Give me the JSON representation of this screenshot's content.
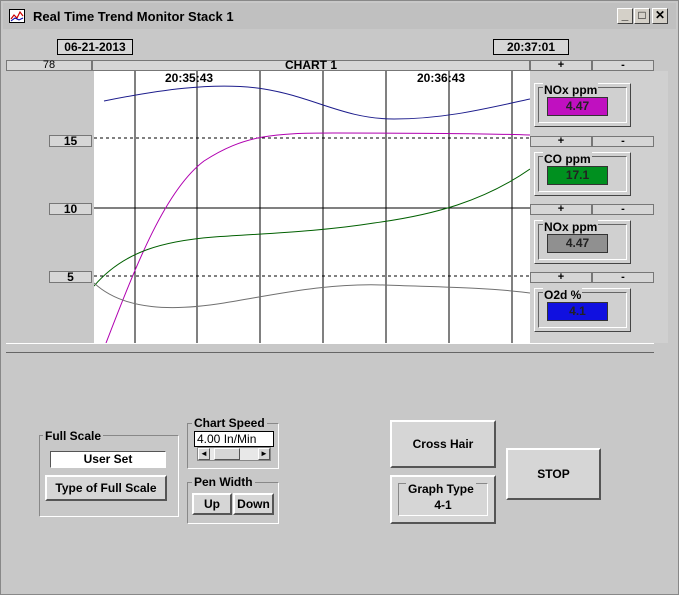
{
  "window": {
    "title": "Real Time Trend Monitor  Stack 1",
    "minimize": "_",
    "maximize": "□",
    "close": "✕"
  },
  "header": {
    "date": "06-21-2013",
    "time": "20:37:01",
    "chart_title": "CHART 1",
    "scroll_label": "78"
  },
  "chart": {
    "timestamps": [
      "20:35:43",
      "20:36:43"
    ],
    "y_labels": [
      "15",
      "10",
      "5"
    ],
    "series_colors": {
      "nox_top": "#1c1c8c",
      "co": "#b000b0",
      "nox": "#006000",
      "o2d": "#707070"
    }
  },
  "channels": [
    {
      "label": "NOx ppm",
      "value": "4.47",
      "color": "#c010c0",
      "plus": "+",
      "minus": "-"
    },
    {
      "label": "CO ppm",
      "value": "17.1",
      "color": "#00901f",
      "plus": "+",
      "minus": "-"
    },
    {
      "label": "NOx ppm",
      "value": "4.47",
      "color": "#909090",
      "plus": "+",
      "minus": "-"
    },
    {
      "label": "O2d %",
      "value": "4.1",
      "color": "#1010e0",
      "plus": "+",
      "minus": "-"
    }
  ],
  "full_scale": {
    "group_label": "Full Scale",
    "value": "User Set",
    "button": "Type of Full Scale"
  },
  "chart_speed": {
    "group_label": "Chart Speed",
    "value": "4.00 In/Min",
    "left_arrow": "◄",
    "right_arrow": "►"
  },
  "pen_width": {
    "group_label": "Pen Width",
    "up": "Up",
    "down": "Down"
  },
  "buttons": {
    "cross_hair": "Cross Hair",
    "stop": "STOP"
  },
  "graph_type": {
    "label": "Graph Type",
    "value": "4-1"
  }
}
